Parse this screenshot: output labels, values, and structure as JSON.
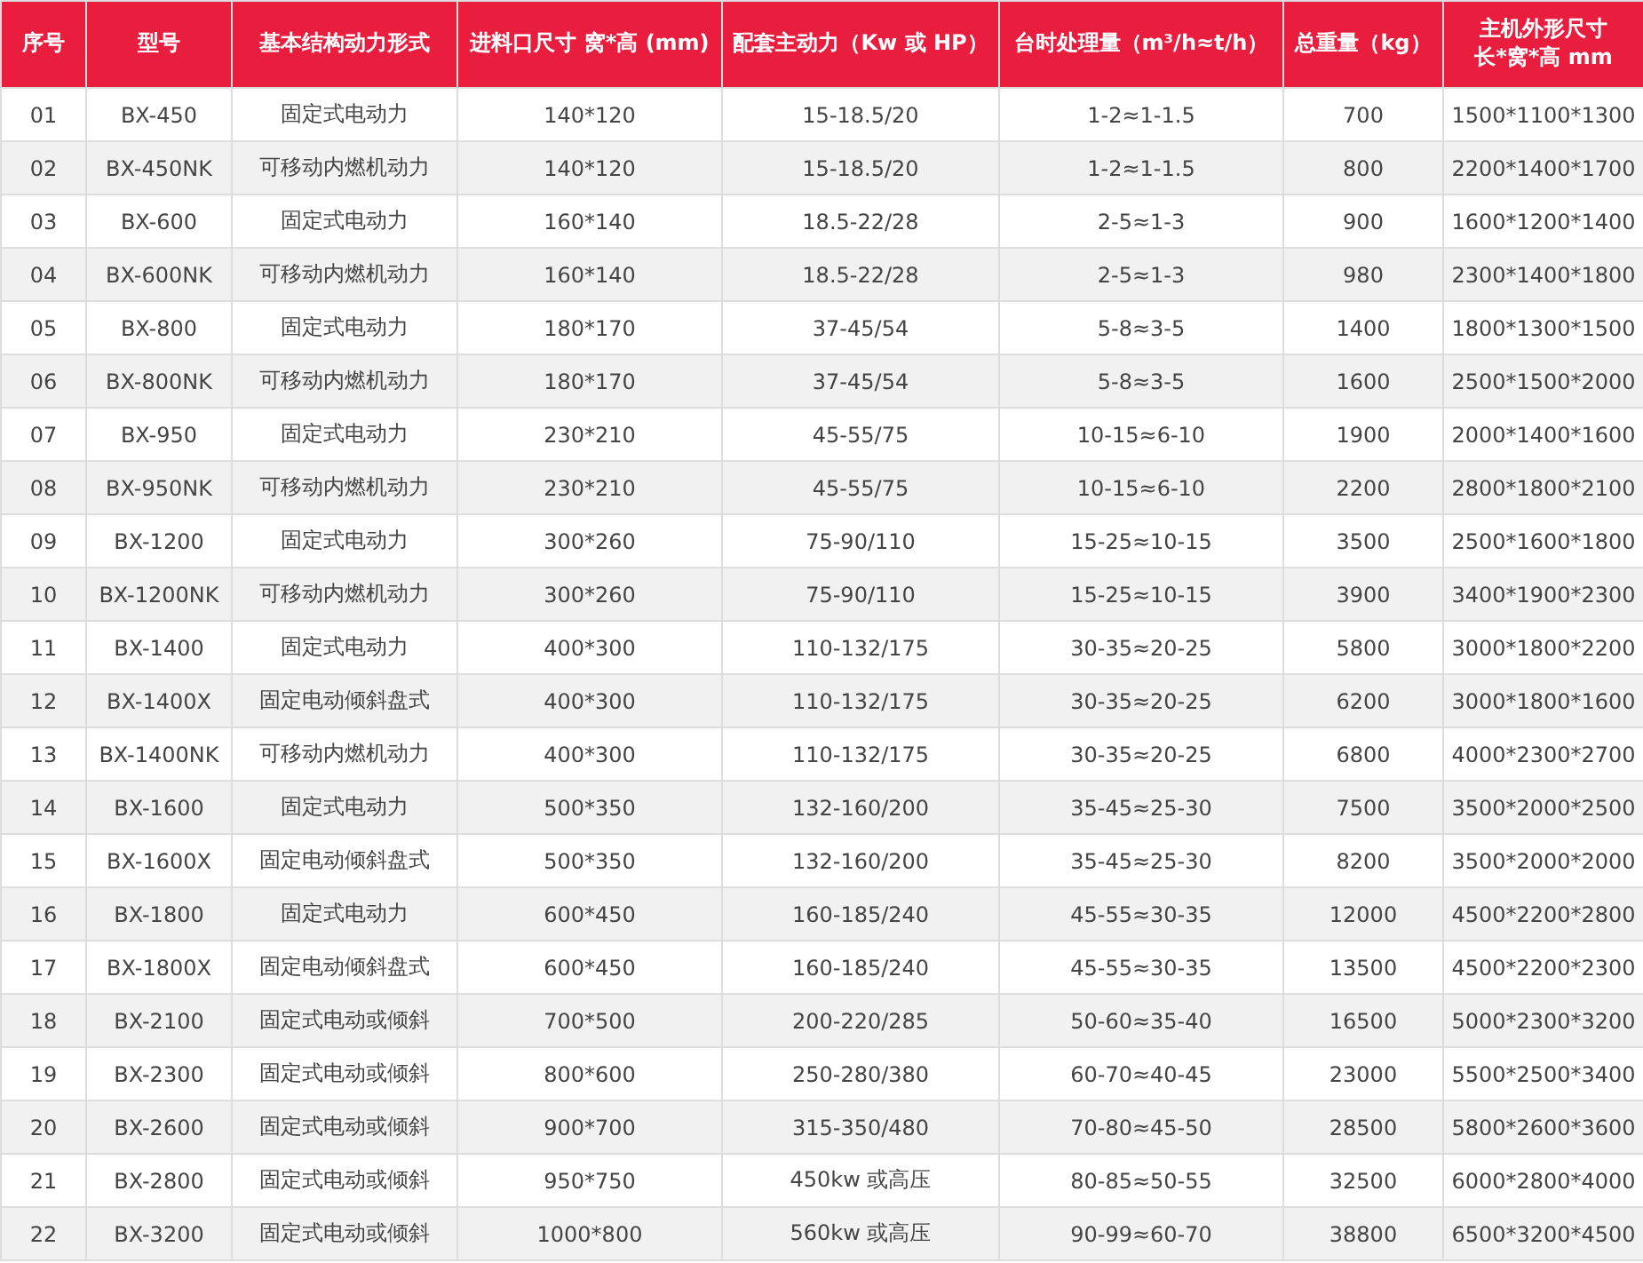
{
  "table": {
    "columns": [
      {
        "lines": [
          "序号"
        ]
      },
      {
        "lines": [
          "型号"
        ]
      },
      {
        "lines": [
          "基本结构动力形式"
        ]
      },
      {
        "lines": [
          "进料口尺寸 窝*高 (mm)"
        ]
      },
      {
        "lines": [
          "配套主动力（Kw 或 HP）"
        ]
      },
      {
        "lines": [
          "台时处理量（m³/h≈t/h）"
        ]
      },
      {
        "lines": [
          "总重量（kg）"
        ]
      },
      {
        "lines": [
          "主机外形尺寸",
          "长*窝*高 mm"
        ]
      }
    ],
    "rows": [
      [
        "01",
        "BX-450",
        "固定式电动力",
        "140*120",
        "15-18.5/20",
        "1-2≈1-1.5",
        "700",
        "1500*1100*1300"
      ],
      [
        "02",
        "BX-450NK",
        "可移动内燃机动力",
        "140*120",
        "15-18.5/20",
        "1-2≈1-1.5",
        "800",
        "2200*1400*1700"
      ],
      [
        "03",
        "BX-600",
        "固定式电动力",
        "160*140",
        "18.5-22/28",
        "2-5≈1-3",
        "900",
        "1600*1200*1400"
      ],
      [
        "04",
        "BX-600NK",
        "可移动内燃机动力",
        "160*140",
        "18.5-22/28",
        "2-5≈1-3",
        "980",
        "2300*1400*1800"
      ],
      [
        "05",
        "BX-800",
        "固定式电动力",
        "180*170",
        "37-45/54",
        "5-8≈3-5",
        "1400",
        "1800*1300*1500"
      ],
      [
        "06",
        "BX-800NK",
        "可移动内燃机动力",
        "180*170",
        "37-45/54",
        "5-8≈3-5",
        "1600",
        "2500*1500*2000"
      ],
      [
        "07",
        "BX-950",
        "固定式电动力",
        "230*210",
        "45-55/75",
        "10-15≈6-10",
        "1900",
        "2000*1400*1600"
      ],
      [
        "08",
        "BX-950NK",
        "可移动内燃机动力",
        "230*210",
        "45-55/75",
        "10-15≈6-10",
        "2200",
        "2800*1800*2100"
      ],
      [
        "09",
        "BX-1200",
        "固定式电动力",
        "300*260",
        "75-90/110",
        "15-25≈10-15",
        "3500",
        "2500*1600*1800"
      ],
      [
        "10",
        "BX-1200NK",
        "可移动内燃机动力",
        "300*260",
        "75-90/110",
        "15-25≈10-15",
        "3900",
        "3400*1900*2300"
      ],
      [
        "11",
        "BX-1400",
        "固定式电动力",
        "400*300",
        "110-132/175",
        "30-35≈20-25",
        "5800",
        "3000*1800*2200"
      ],
      [
        "12",
        "BX-1400X",
        "固定电动倾斜盘式",
        "400*300",
        "110-132/175",
        "30-35≈20-25",
        "6200",
        "3000*1800*1600"
      ],
      [
        "13",
        "BX-1400NK",
        "可移动内燃机动力",
        "400*300",
        "110-132/175",
        "30-35≈20-25",
        "6800",
        "4000*2300*2700"
      ],
      [
        "14",
        "BX-1600",
        "固定式电动力",
        "500*350",
        "132-160/200",
        "35-45≈25-30",
        "7500",
        "3500*2000*2500"
      ],
      [
        "15",
        "BX-1600X",
        "固定电动倾斜盘式",
        "500*350",
        "132-160/200",
        "35-45≈25-30",
        "8200",
        "3500*2000*2000"
      ],
      [
        "16",
        "BX-1800",
        "固定式电动力",
        "600*450",
        "160-185/240",
        "45-55≈30-35",
        "12000",
        "4500*2200*2800"
      ],
      [
        "17",
        "BX-1800X",
        "固定电动倾斜盘式",
        "600*450",
        "160-185/240",
        "45-55≈30-35",
        "13500",
        "4500*2200*2300"
      ],
      [
        "18",
        "BX-2100",
        "固定式电动或倾斜",
        "700*500",
        "200-220/285",
        "50-60≈35-40",
        "16500",
        "5000*2300*3200"
      ],
      [
        "19",
        "BX-2300",
        "固定式电动或倾斜",
        "800*600",
        "250-280/380",
        "60-70≈40-45",
        "23000",
        "5500*2500*3400"
      ],
      [
        "20",
        "BX-2600",
        "固定式电动或倾斜",
        "900*700",
        "315-350/480",
        "70-80≈45-50",
        "28500",
        "5800*2600*3600"
      ],
      [
        "21",
        "BX-2800",
        "固定式电动或倾斜",
        "950*750",
        "450kw 或高压",
        "80-85≈50-55",
        "32500",
        "6000*2800*4000"
      ],
      [
        "22",
        "BX-3200",
        "固定式电动或倾斜",
        "1000*800",
        "560kw 或高压",
        "90-99≈60-70",
        "38800",
        "6500*3200*4500"
      ]
    ]
  }
}
